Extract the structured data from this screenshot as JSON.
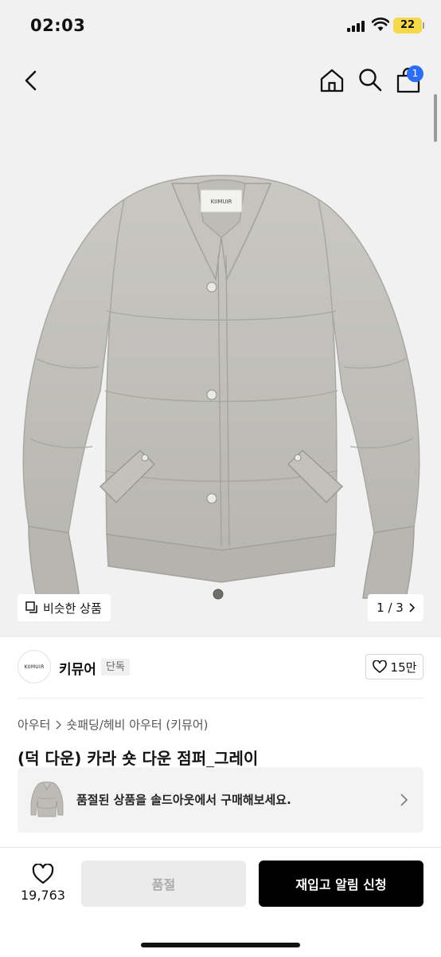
{
  "status_bar": {
    "time": "02:03",
    "battery": "22"
  },
  "nav": {
    "back_icon": "chevron-left-icon",
    "home_icon": "home-icon",
    "search_icon": "search-icon",
    "bag_icon": "shopping-bag-icon",
    "bag_count": "1",
    "badge_color": "#2d6cf4"
  },
  "gallery": {
    "jacket_label": "KIIMUIR",
    "similar_label": "비슷한 상품",
    "page_indicator": "1 / 3"
  },
  "brand": {
    "logo_text": "KIIMUIR",
    "name": "키뮤어",
    "tag": "단독",
    "likes": "15만"
  },
  "product": {
    "breadcrumb": [
      "아우터",
      "숏패딩/헤비 아우터 (키뮤어)"
    ],
    "title": "(덕 다운) 카라 숏 다운 점퍼_그레이",
    "soldout_notice": "품절된 상품을 솔드아웃에서 구매해보세요."
  },
  "bottom_bar": {
    "wish_count": "19,763",
    "soldout_label": "품절",
    "restock_label": "재입고 알림 신청"
  }
}
